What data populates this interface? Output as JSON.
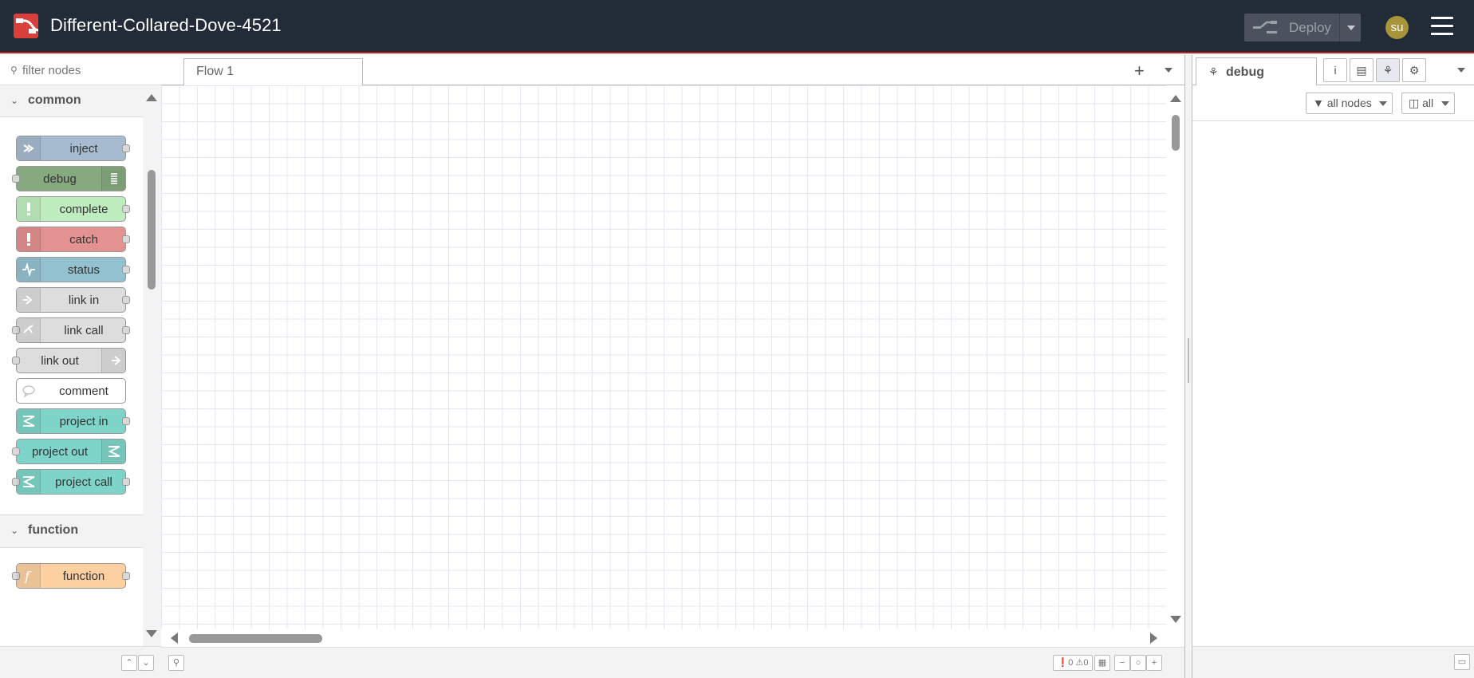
{
  "header": {
    "title": "Different-Collared-Dove-4521",
    "deploy_label": "Deploy",
    "avatar_text": "su",
    "brand_color": "#222b38",
    "accent_color": "#c02020"
  },
  "palette": {
    "search_placeholder": "filter nodes",
    "categories": [
      {
        "label": "common",
        "nodes": [
          {
            "label": "inject",
            "color": "#a6bbcf",
            "icon": "arrow-in-icon"
          },
          {
            "label": "debug",
            "color": "#87a980",
            "icon": "list-icon"
          },
          {
            "label": "complete",
            "color": "#c0edc0",
            "icon": "exclamation-icon"
          },
          {
            "label": "catch",
            "color": "#e49191",
            "icon": "exclamation-icon"
          },
          {
            "label": "status",
            "color": "#94c1d0",
            "icon": "pulse-icon"
          },
          {
            "label": "link in",
            "color": "#dddddd",
            "icon": "link-in-icon"
          },
          {
            "label": "link call",
            "color": "#dddddd",
            "icon": "link-call-icon"
          },
          {
            "label": "link out",
            "color": "#dddddd",
            "icon": "link-out-icon"
          },
          {
            "label": "comment",
            "color": "#ffffff",
            "icon": "comment-icon"
          },
          {
            "label": "project in",
            "color": "#7ed4c9",
            "icon": "project-icon"
          },
          {
            "label": "project out",
            "color": "#7ed4c9",
            "icon": "project-icon"
          },
          {
            "label": "project call",
            "color": "#7ed4c9",
            "icon": "project-icon"
          }
        ]
      },
      {
        "label": "function",
        "nodes": [
          {
            "label": "function",
            "color": "#fdd0a2",
            "icon": "function-icon"
          }
        ]
      }
    ]
  },
  "workspace": {
    "tabs": [
      {
        "label": "Flow 1"
      }
    ],
    "add_flow_label": "+",
    "errors_count": "0",
    "warnings_count": "0"
  },
  "sidebar": {
    "active_tab": "debug",
    "filter_nodes_label": "all nodes",
    "clear_label": "all"
  }
}
